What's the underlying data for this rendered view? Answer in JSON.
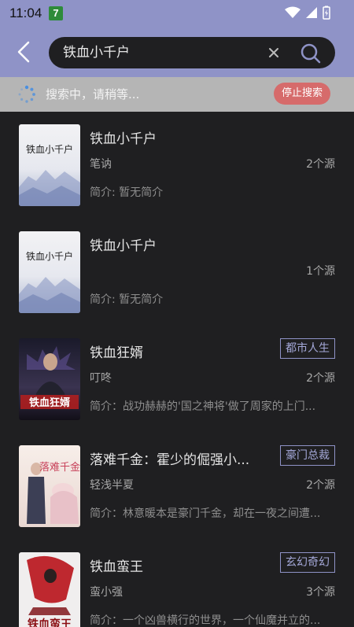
{
  "status_bar": {
    "time": "11:04",
    "badge": "7"
  },
  "search": {
    "query": "铁血小千户"
  },
  "search_status": {
    "text": "搜索中，请稍等...",
    "stop_label": "停止搜索"
  },
  "colors": {
    "accent": "#8f93c7",
    "background": "#1f1f21",
    "stop_button": "#d66b6b",
    "tag_border": "#8f93c7"
  },
  "books": [
    {
      "title": "铁血小千户",
      "author": "笔讷",
      "sources": "2个源",
      "intro": "简介: 暂无简介",
      "tag": ""
    },
    {
      "title": "铁血小千户",
      "author": "",
      "sources": "1个源",
      "intro": "简介: 暂无简介",
      "tag": ""
    },
    {
      "title": "铁血狂婿",
      "author": "叮咚",
      "sources": "2个源",
      "intro": "简介：战功赫赫的'国之神将'做了周家的上门...",
      "tag": "都市人生"
    },
    {
      "title": "落难千金：霍少的倔强小...",
      "author": "轻浅半夏",
      "sources": "2个源",
      "intro": "简介：林意暖本是豪门千金，却在一夜之间遭...",
      "tag": "豪门总裁"
    },
    {
      "title": "铁血蛮王",
      "author": "蛮小强",
      "sources": "3个源",
      "intro": "简介：一个凶兽横行的世界，一个仙魔并立的...",
      "tag": "玄幻奇幻"
    }
  ],
  "cover_texts": [
    "铁血小千户",
    "铁血小千户",
    "铁血狂婿",
    "落难千金",
    "铁血蛮王"
  ]
}
